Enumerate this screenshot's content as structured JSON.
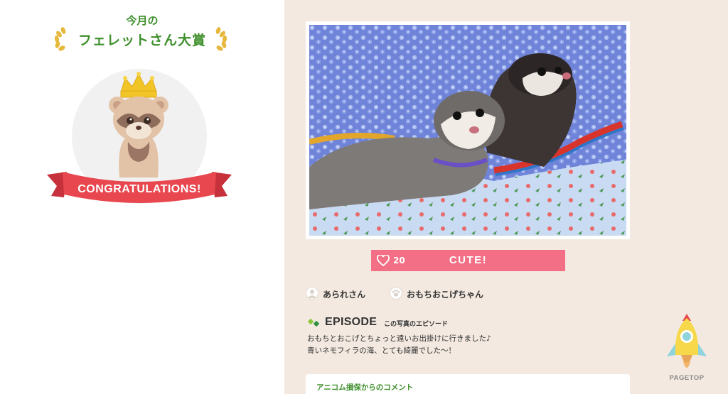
{
  "award": {
    "subtitle": "今月の",
    "title": "フェレットさん大賞",
    "banner": "CONGRATULATIONS!"
  },
  "photo": {
    "like_count": "20",
    "vote_label": "CUTE!"
  },
  "owner": {
    "user_name": "あられさん",
    "pet_name": "おもちおこげちゃん"
  },
  "episode": {
    "title": "EPISODE",
    "subtitle": "この写真のエピソード",
    "line1": "おもちとおこげとちょっと遠いお出掛けに行きました♪",
    "line2": "青いネモフィラの海、とても綺麗でした～！"
  },
  "comment": {
    "title": "アニコム損保からのコメント"
  },
  "pagetop": {
    "label": "PAGETOP"
  },
  "colors": {
    "award_green": "#3f8f2c",
    "vote_pink": "#f36f86",
    "panel_beige": "#f3e9e0",
    "ribbon_red": "#e8474f"
  }
}
